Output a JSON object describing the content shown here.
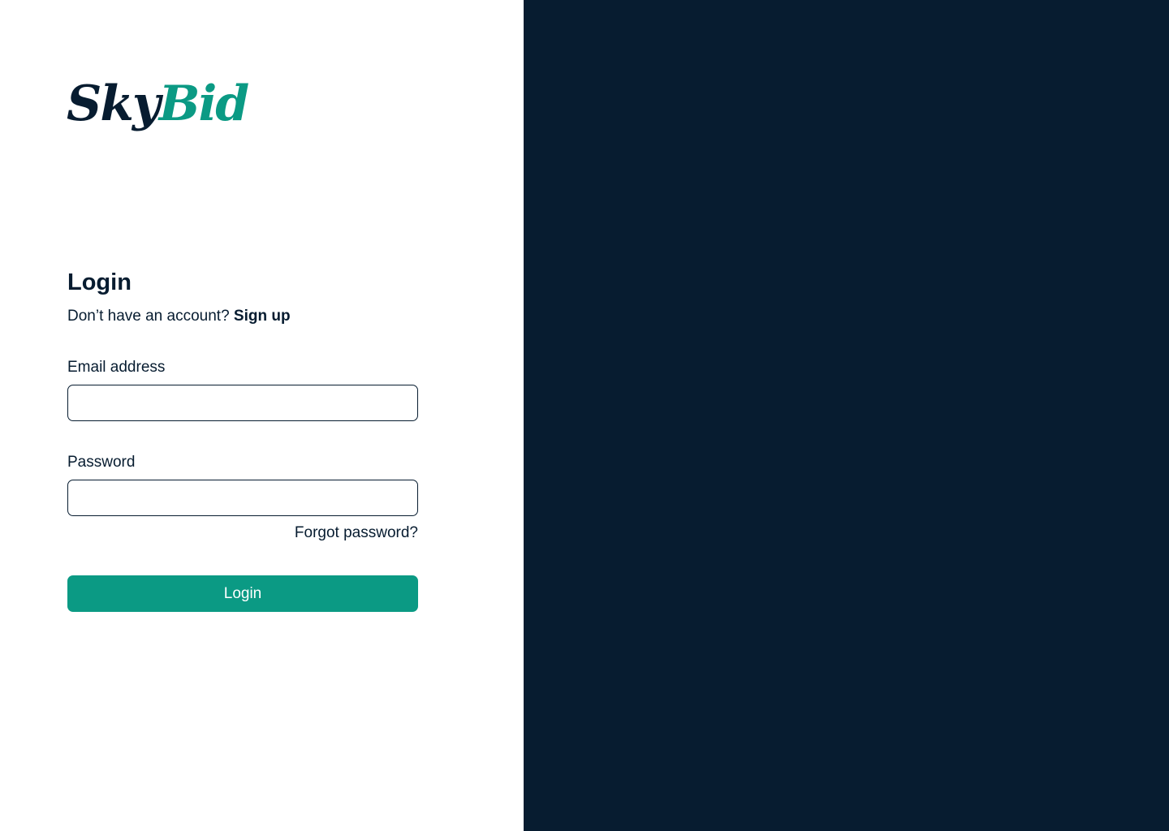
{
  "brand": {
    "logo_part1": "Sky",
    "logo_part2": "Bid",
    "colors": {
      "navy": "#071c30",
      "teal": "#0b9a84",
      "background": "#ffffff"
    }
  },
  "login": {
    "title": "Login",
    "signup_prompt": "Don’t have an account?",
    "signup_link": "Sign up",
    "email_label": "Email address",
    "email_value": "",
    "password_label": "Password",
    "password_value": "",
    "forgot_password": "Forgot password?",
    "submit_label": "Login"
  }
}
